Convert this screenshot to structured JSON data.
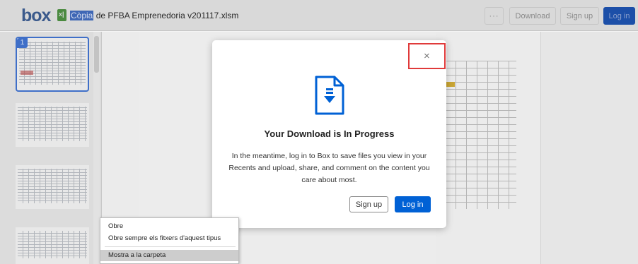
{
  "header": {
    "logo": "box",
    "file_title_highlight": "Còpia",
    "file_title_rest": " de PFBA Emprenedoria v201117.xlsm",
    "more_label": "···",
    "download_label": "Download",
    "signup_label": "Sign up",
    "login_label": "Log in"
  },
  "sidebar": {
    "selected_page": "1"
  },
  "modal": {
    "title": "Your Download is In Progress",
    "body": "In the meantime, log in to Box to save files you view in your Recents and upload, share, and comment on the content you care about most.",
    "close_label": "×",
    "signup_label": "Sign up",
    "login_label": "Log in",
    "icon": "download-file-icon",
    "accent": "#0061d5"
  },
  "context_menu": {
    "items": [
      {
        "label": "Obre"
      },
      {
        "label": "Obre sempre els fitxers d'aquest tipus"
      },
      {
        "label": "Mostra a la carpeta"
      }
    ]
  },
  "colors": {
    "highlight_box": "#e03a3a",
    "login_button": "#1c4fa8"
  }
}
